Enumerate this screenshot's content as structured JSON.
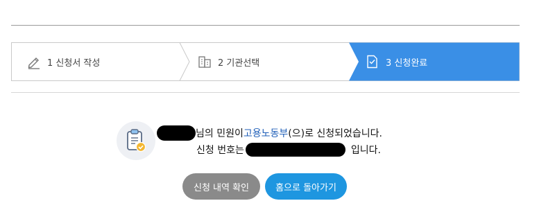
{
  "stepper": {
    "steps": [
      {
        "label": "1 신청서 작성",
        "icon": "pencil-icon",
        "active": false
      },
      {
        "label": "2 기관선택",
        "icon": "building-icon",
        "active": false
      },
      {
        "label": "3 신청완료",
        "icon": "document-check-icon",
        "active": true
      }
    ],
    "active_color": "#3a8fe6"
  },
  "result": {
    "line1_suffix": "님의 민원이 ",
    "agency": "고용노동부",
    "line1_end": "(으)로 신청되었습니다.",
    "line2_prefix": "신청 번호는",
    "line2_suffix": "입니다."
  },
  "buttons": {
    "view_history": "신청 내역 확인",
    "go_home": "홈으로 돌아가기"
  },
  "colors": {
    "agency_link": "#1f5fb8",
    "gray_button": "#8a8a8a",
    "blue_button": "#1e96e0"
  }
}
